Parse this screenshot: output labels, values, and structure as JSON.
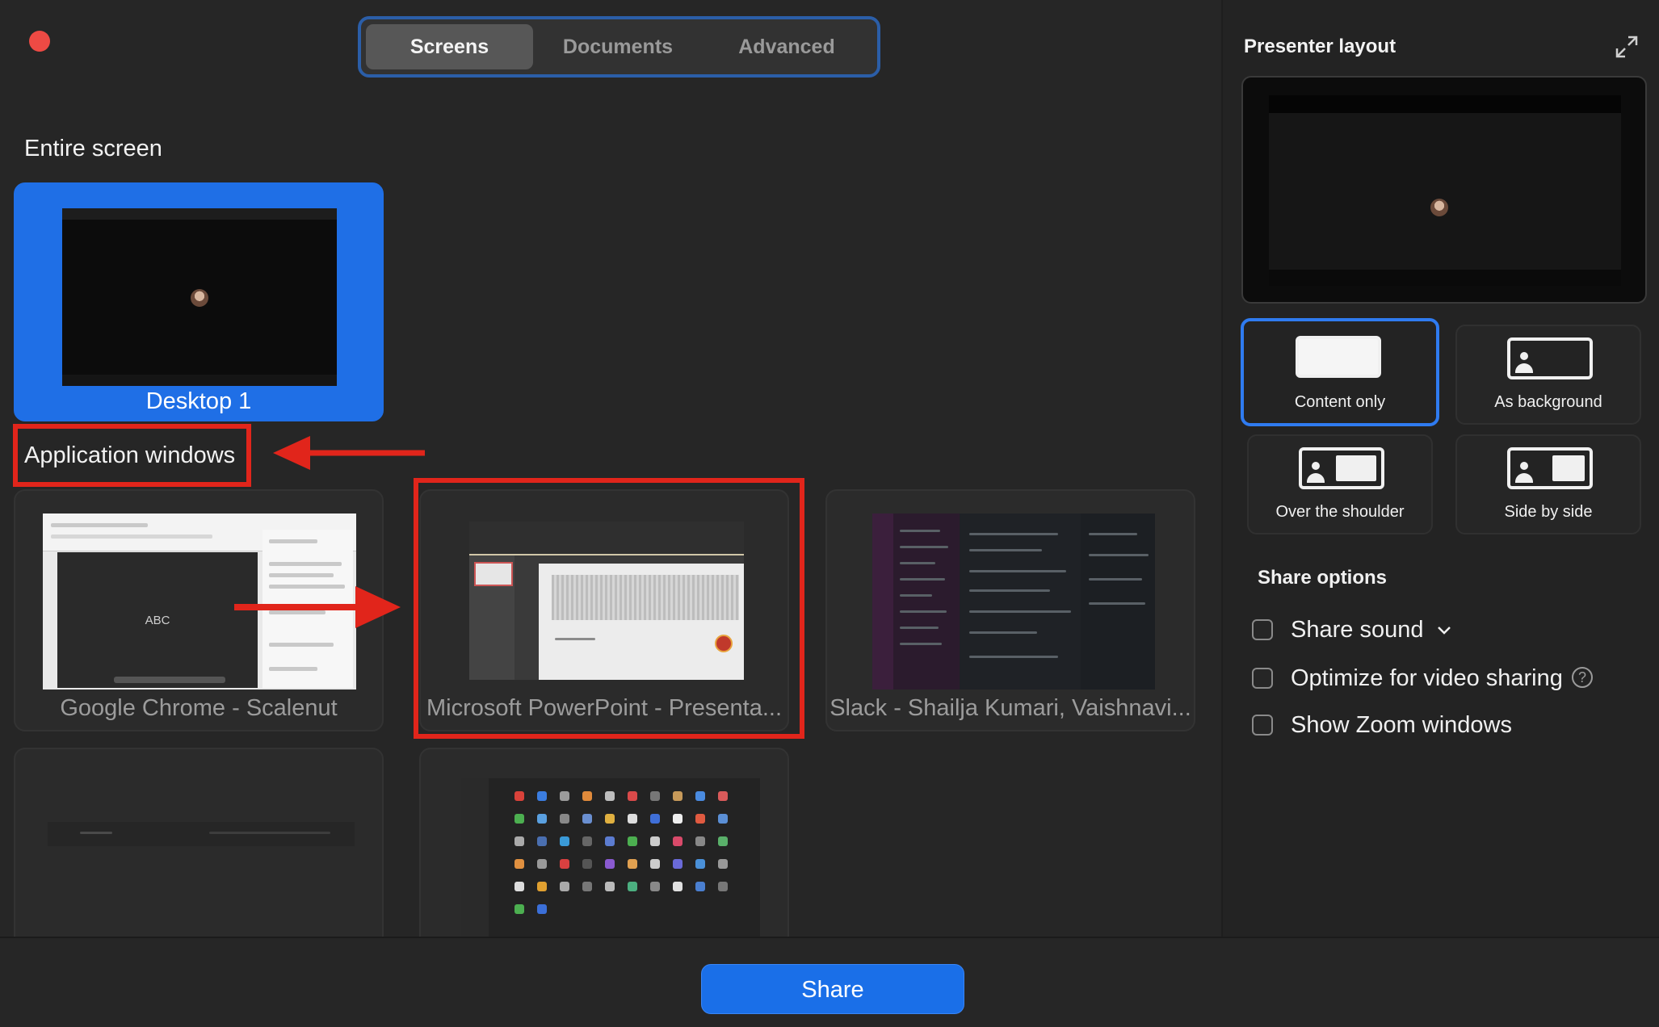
{
  "tabs": [
    "Screens",
    "Documents",
    "Advanced"
  ],
  "active_tab": "Screens",
  "entire_screen": {
    "title": "Entire screen",
    "desktop_label": "Desktop 1"
  },
  "application_windows": {
    "title": "Application windows",
    "items": [
      {
        "label": "Google Chrome - Scalenut",
        "thumb_text": "ABC"
      },
      {
        "label": "Microsoft PowerPoint - Presenta..."
      },
      {
        "label": "Slack - Shailja Kumari, Vaishnavi..."
      },
      {
        "label": ""
      },
      {
        "label": ""
      }
    ]
  },
  "presenter_layout": {
    "title": "Presenter layout",
    "options": [
      "Content only",
      "As background",
      "Over the shoulder",
      "Side by side"
    ],
    "selected": "Content only"
  },
  "share_options": {
    "title": "Share options",
    "items": [
      "Share sound",
      "Optimize for video sharing",
      "Show Zoom windows"
    ]
  },
  "share_button": "Share",
  "icons": [
    "close-dot",
    "expand-icon",
    "chevron-down-icon",
    "help-icon"
  ],
  "colors": {
    "accent": "#1f6fe6",
    "annotation_red": "#e1251b",
    "background": "#262626"
  }
}
